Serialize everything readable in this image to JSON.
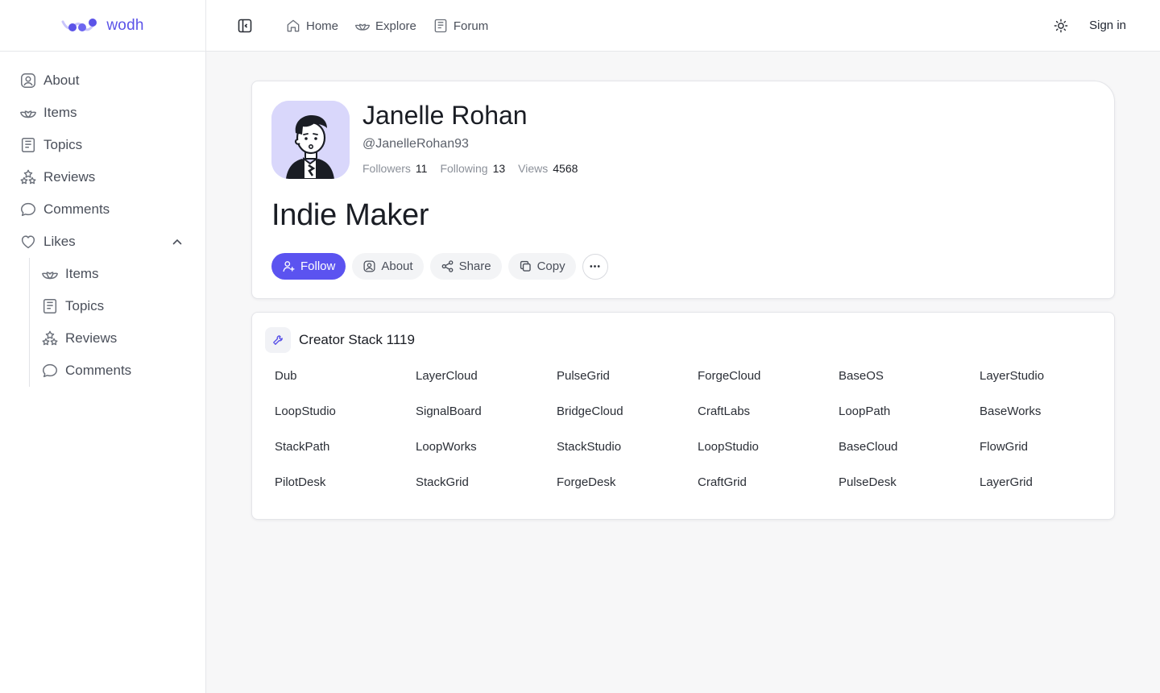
{
  "brand": {
    "name": "wodh",
    "accent": "#5b53e8"
  },
  "sidebar": {
    "items": [
      {
        "label": "About",
        "icon": "user-circle-icon"
      },
      {
        "label": "Items",
        "icon": "lotus-icon"
      },
      {
        "label": "Topics",
        "icon": "document-icon"
      },
      {
        "label": "Reviews",
        "icon": "stack-stars-icon"
      },
      {
        "label": "Comments",
        "icon": "chat-bubble-icon"
      }
    ],
    "likes": {
      "label": "Likes",
      "icon": "heart-icon",
      "expanded": true,
      "children": [
        {
          "label": "Items",
          "icon": "lotus-icon"
        },
        {
          "label": "Topics",
          "icon": "document-icon"
        },
        {
          "label": "Reviews",
          "icon": "stack-stars-icon"
        },
        {
          "label": "Comments",
          "icon": "chat-bubble-icon"
        }
      ]
    }
  },
  "topbar": {
    "nav": [
      {
        "label": "Home",
        "icon": "home-icon"
      },
      {
        "label": "Explore",
        "icon": "lotus-icon"
      },
      {
        "label": "Forum",
        "icon": "document-icon"
      }
    ],
    "signin_label": "Sign in"
  },
  "profile": {
    "name": "Janelle Rohan",
    "handle": "@JanelleRohan93",
    "stats": [
      {
        "label": "Followers",
        "value": "11"
      },
      {
        "label": "Following",
        "value": "13"
      },
      {
        "label": "Views",
        "value": "4568"
      }
    ],
    "role": "Indie Maker",
    "actions": {
      "follow": "Follow",
      "about": "About",
      "share": "Share",
      "copy": "Copy"
    }
  },
  "stack": {
    "title": "Creator Stack 1119",
    "items": [
      "Dub",
      "LayerCloud",
      "PulseGrid",
      "ForgeCloud",
      "BaseOS",
      "LayerStudio",
      "LoopStudio",
      "SignalBoard",
      "BridgeCloud",
      "CraftLabs",
      "LoopPath",
      "BaseWorks",
      "StackPath",
      "LoopWorks",
      "StackStudio",
      "LoopStudio",
      "BaseCloud",
      "FlowGrid",
      "PilotDesk",
      "StackGrid",
      "ForgeDesk",
      "CraftGrid",
      "PulseDesk",
      "LayerGrid"
    ]
  }
}
